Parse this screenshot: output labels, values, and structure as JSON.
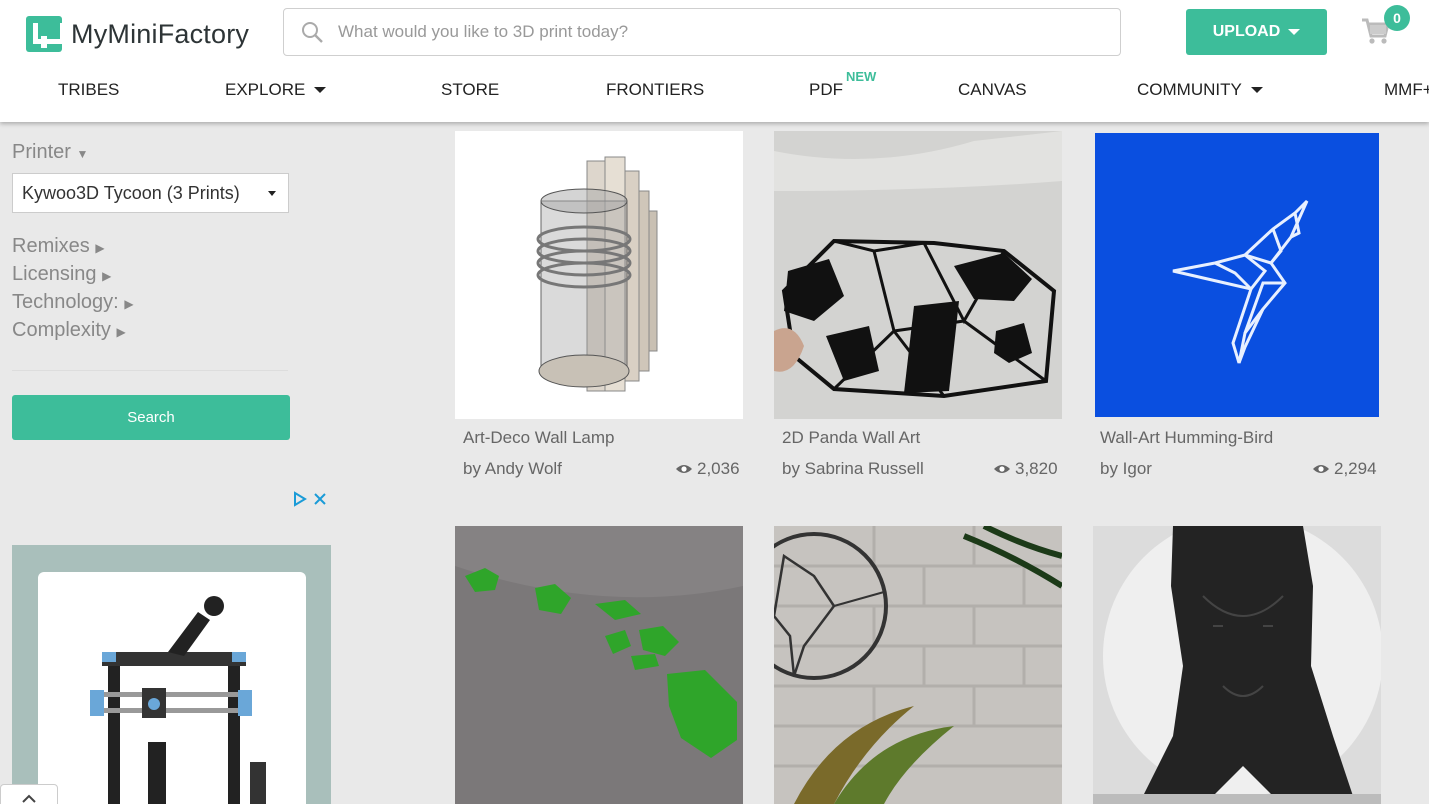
{
  "header": {
    "logo_text": "MyMiniFactory",
    "search_placeholder": "What would you like to 3D print today?",
    "upload_label": "UPLOAD",
    "cart_count": "0"
  },
  "nav": {
    "items": [
      "TRIBES",
      "EXPLORE",
      "STORE",
      "FRONTIERS",
      "PDF",
      "CANVAS",
      "COMMUNITY",
      "MMF+"
    ],
    "new_badge": "NEW"
  },
  "sidebar": {
    "printer_label": "Printer",
    "printer_value": "Kywoo3D Tycoon (3 Prints)",
    "filters": [
      "Remixes",
      "Licensing",
      "Technology:",
      "Complexity"
    ],
    "search_button": "Search"
  },
  "results": [
    {
      "title": "Art-Deco Wall Lamp",
      "author": "by Andy Wolf",
      "views": "2,036"
    },
    {
      "title": "2D Panda Wall Art",
      "author": "by Sabrina Russell",
      "views": "3,820"
    },
    {
      "title": "Wall-Art Humming-Bird",
      "author": "by Igor",
      "views": "2,294"
    },
    {
      "title": "",
      "author": "",
      "views": ""
    },
    {
      "title": "",
      "author": "",
      "views": ""
    },
    {
      "title": "",
      "author": "",
      "views": ""
    }
  ],
  "colors": {
    "accent": "#3dbd9a",
    "bird_bg": "#0a4fe0"
  }
}
